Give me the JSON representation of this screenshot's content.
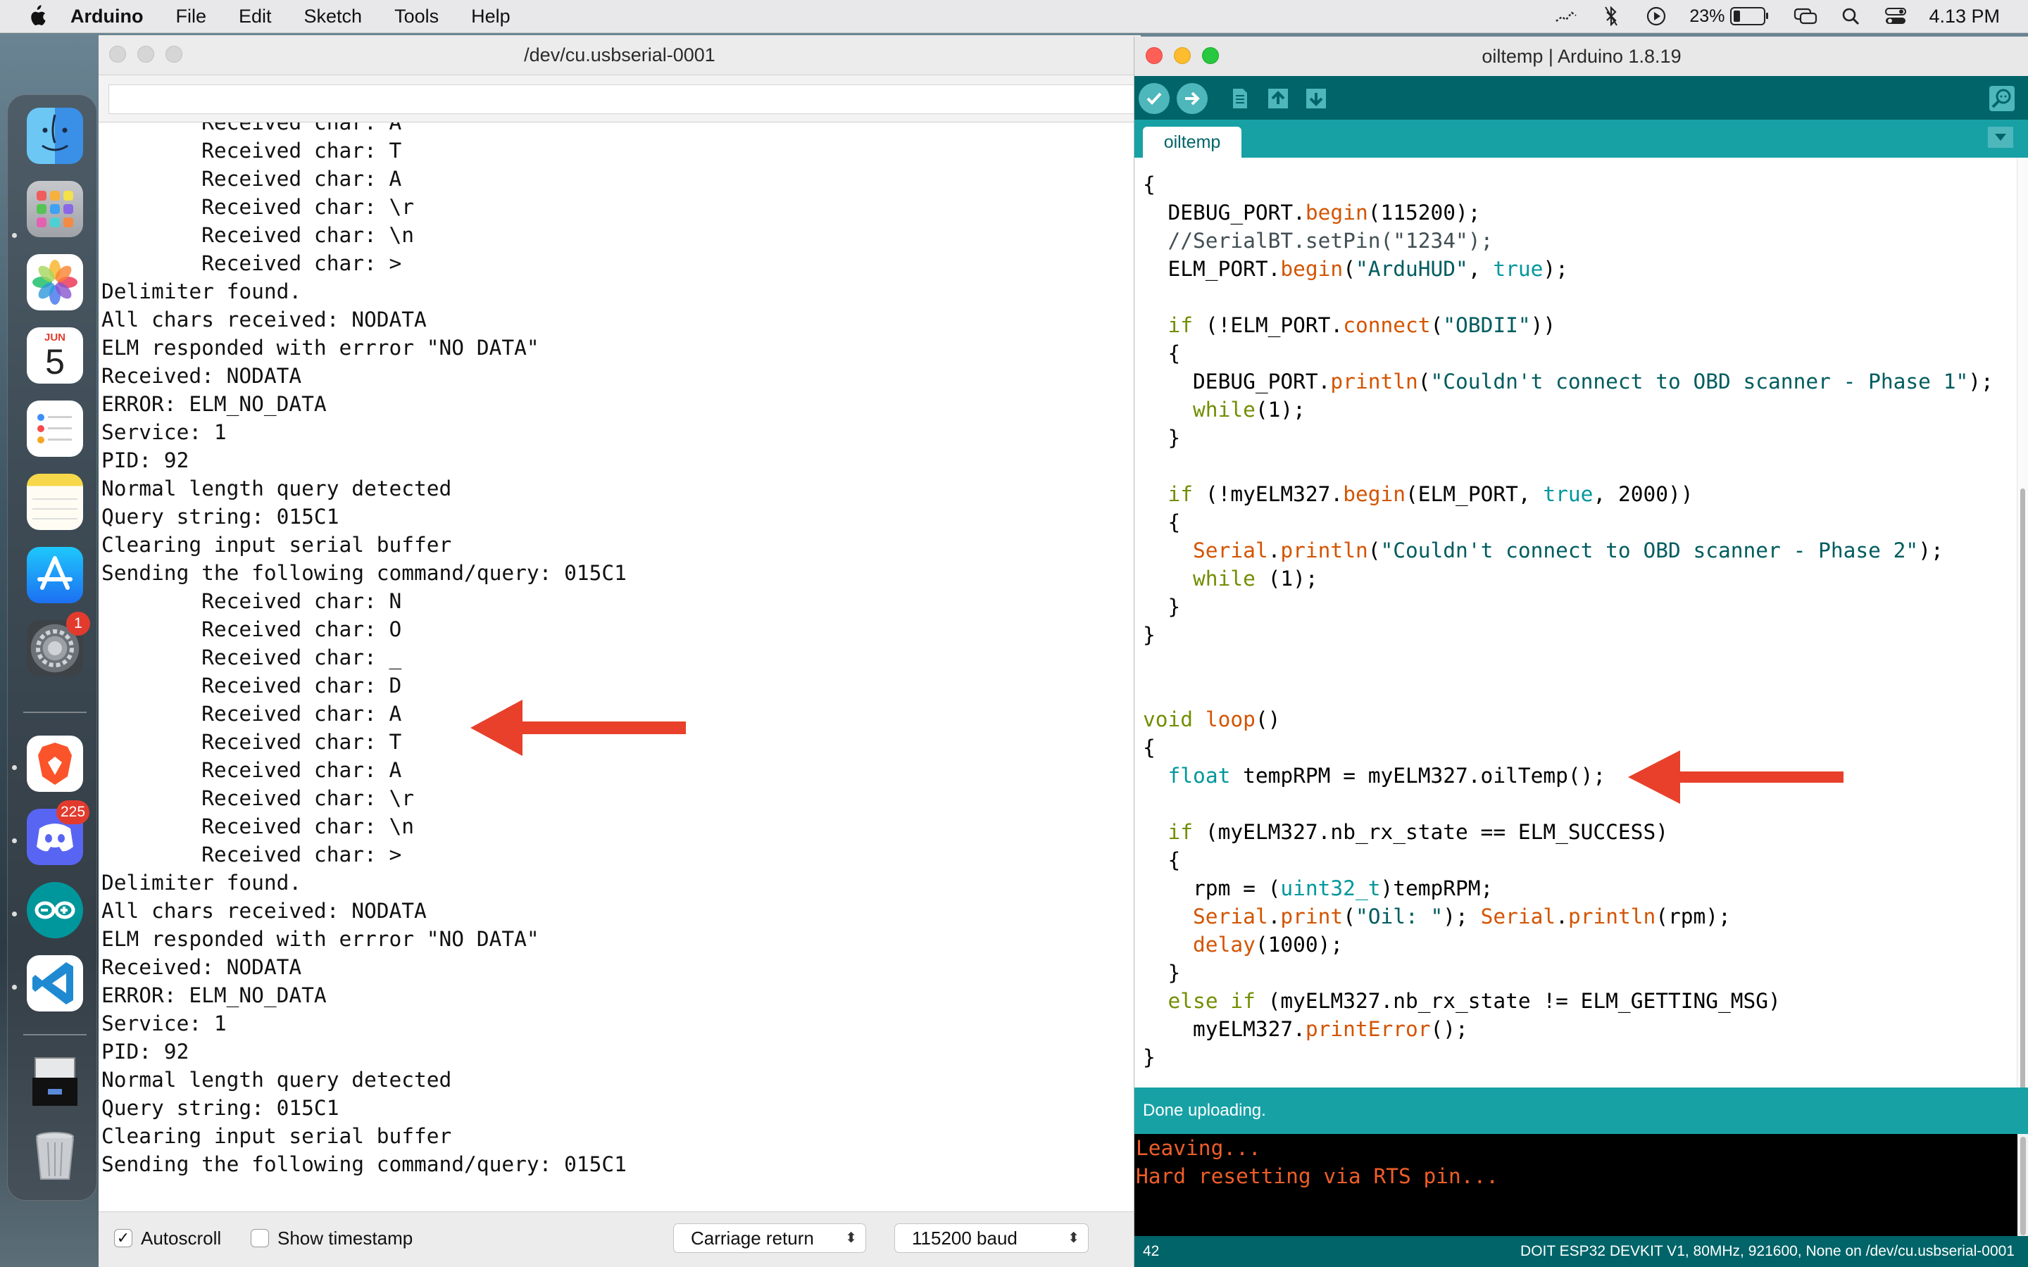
{
  "menubar": {
    "app_name": "Arduino",
    "menus": [
      "File",
      "Edit",
      "Sketch",
      "Tools",
      "Help"
    ],
    "battery_percent": "23%",
    "battery_level": 0.23,
    "clock": "4.13 PM"
  },
  "dock": {
    "apps": [
      {
        "name": "Finder",
        "icon": "finder-icon"
      },
      {
        "name": "Launchpad",
        "icon": "launchpad-icon"
      },
      {
        "name": "Photos",
        "icon": "photos-icon"
      },
      {
        "name": "Calendar",
        "icon": "calendar-icon",
        "month": "JUN",
        "day": "5"
      },
      {
        "name": "Reminders",
        "icon": "reminders-icon"
      },
      {
        "name": "Notes",
        "icon": "notes-icon"
      },
      {
        "name": "App Store",
        "icon": "app-store-icon"
      },
      {
        "name": "System Preferences",
        "icon": "system-preferences-icon",
        "badge": "1"
      },
      {
        "name": "Brave",
        "icon": "brave-icon"
      },
      {
        "name": "Discord",
        "icon": "discord-icon",
        "badge": "225"
      },
      {
        "name": "Arduino",
        "icon": "arduino-icon"
      },
      {
        "name": "Visual Studio Code",
        "icon": "vscode-icon"
      },
      {
        "name": "Document",
        "icon": "document-icon"
      },
      {
        "name": "Trash",
        "icon": "trash-icon"
      }
    ]
  },
  "serial_monitor": {
    "title": "/dev/cu.usbserial-0001",
    "input_value": "",
    "lines": [
      "        Received char: A",
      "        Received char: T",
      "        Received char: A",
      "        Received char: \\r",
      "        Received char: \\n",
      "        Received char: >",
      "Delimiter found.",
      "All chars received: NODATA",
      "ELM responded with errror \"NO DATA\"",
      "Received: NODATA",
      "ERROR: ELM_NO_DATA",
      "Service: 1",
      "PID: 92",
      "Normal length query detected",
      "Query string: 015C1",
      "Clearing input serial buffer",
      "Sending the following command/query: 015C1",
      "        Received char: N",
      "        Received char: O",
      "        Received char: _",
      "        Received char: D",
      "        Received char: A",
      "        Received char: T",
      "        Received char: A",
      "        Received char: \\r",
      "        Received char: \\n",
      "        Received char: >",
      "Delimiter found.",
      "All chars received: NODATA",
      "ELM responded with errror \"NO DATA\"",
      "Received: NODATA",
      "ERROR: ELM_NO_DATA",
      "Service: 1",
      "PID: 92",
      "Normal length query detected",
      "Query string: 015C1",
      "Clearing input serial buffer",
      "Sending the following command/query: 015C1"
    ],
    "autoscroll_label": "Autoscroll",
    "autoscroll_checked": true,
    "timestamp_label": "Show timestamp",
    "timestamp_checked": false,
    "line_ending": "Carriage return",
    "baud": "115200 baud"
  },
  "ide": {
    "title": "oiltemp | Arduino 1.8.19",
    "tab": "oiltemp",
    "toolbar": [
      {
        "name": "verify",
        "icon": "check-icon"
      },
      {
        "name": "upload",
        "icon": "arrow-right-icon"
      },
      {
        "name": "new",
        "icon": "new-file-icon"
      },
      {
        "name": "open",
        "icon": "open-icon"
      },
      {
        "name": "save",
        "icon": "save-icon"
      },
      {
        "name": "serial monitor",
        "icon": "serial-monitor-icon"
      }
    ],
    "code": [
      [
        [
          "{",
          ""
        ]
      ],
      [
        [
          "  ",
          ""
        ],
        [
          "DEBUG_PORT",
          ""
        ],
        [
          ".",
          ""
        ],
        [
          "begin",
          "kw-orange"
        ],
        [
          "(115200);",
          ""
        ]
      ],
      [
        [
          "  //SerialBT.setPin(\"1234\");",
          "cmt"
        ]
      ],
      [
        [
          "  ELM_PORT.",
          ""
        ],
        [
          "begin",
          "kw-orange"
        ],
        [
          "(",
          ""
        ],
        [
          "\"ArduHUD\"",
          "str"
        ],
        [
          ", ",
          ""
        ],
        [
          "true",
          "kw-teal"
        ],
        [
          ");",
          ""
        ]
      ],
      [
        [
          "",
          ""
        ]
      ],
      [
        [
          "  ",
          ""
        ],
        [
          "if",
          "kw-olive"
        ],
        [
          " (!ELM_PORT.",
          ""
        ],
        [
          "connect",
          "kw-orange"
        ],
        [
          "(",
          ""
        ],
        [
          "\"OBDII\"",
          "str"
        ],
        [
          "))",
          ""
        ]
      ],
      [
        [
          "  {",
          ""
        ]
      ],
      [
        [
          "    DEBUG_PORT.",
          ""
        ],
        [
          "println",
          "kw-orange"
        ],
        [
          "(",
          ""
        ],
        [
          "\"Couldn't connect to OBD scanner - Phase 1\"",
          "str"
        ],
        [
          ");",
          ""
        ]
      ],
      [
        [
          "    ",
          ""
        ],
        [
          "while",
          "kw-olive"
        ],
        [
          "(1);",
          ""
        ]
      ],
      [
        [
          "  }",
          ""
        ]
      ],
      [
        [
          "",
          ""
        ]
      ],
      [
        [
          "  ",
          ""
        ],
        [
          "if",
          "kw-olive"
        ],
        [
          " (!myELM327.",
          ""
        ],
        [
          "begin",
          "kw-orange"
        ],
        [
          "(ELM_PORT, ",
          ""
        ],
        [
          "true",
          "kw-teal"
        ],
        [
          ", 2000))",
          ""
        ]
      ],
      [
        [
          "  {",
          ""
        ]
      ],
      [
        [
          "    ",
          ""
        ],
        [
          "Serial",
          "kw-orange"
        ],
        [
          ".",
          ""
        ],
        [
          "println",
          "kw-orange"
        ],
        [
          "(",
          ""
        ],
        [
          "\"Couldn't connect to OBD scanner - Phase 2\"",
          "str"
        ],
        [
          ");",
          ""
        ]
      ],
      [
        [
          "    ",
          ""
        ],
        [
          "while",
          "kw-olive"
        ],
        [
          " (1);",
          ""
        ]
      ],
      [
        [
          "  }",
          ""
        ]
      ],
      [
        [
          "}",
          ""
        ]
      ],
      [
        [
          "",
          ""
        ]
      ],
      [
        [
          "",
          ""
        ]
      ],
      [
        [
          "void",
          "kw-olive"
        ],
        [
          " ",
          ""
        ],
        [
          "loop",
          "kw-orange"
        ],
        [
          "()",
          ""
        ]
      ],
      [
        [
          "{",
          ""
        ]
      ],
      [
        [
          "  ",
          ""
        ],
        [
          "float",
          "kw-teal"
        ],
        [
          " tempRPM = myELM327.oilTemp();",
          ""
        ]
      ],
      [
        [
          "",
          ""
        ]
      ],
      [
        [
          "  ",
          ""
        ],
        [
          "if",
          "kw-olive"
        ],
        [
          " (myELM327.nb_rx_state == ELM_SUCCESS)",
          ""
        ]
      ],
      [
        [
          "  {",
          ""
        ]
      ],
      [
        [
          "    rpm = (",
          ""
        ],
        [
          "uint32_t",
          "kw-teal"
        ],
        [
          ")tempRPM;",
          ""
        ]
      ],
      [
        [
          "    ",
          ""
        ],
        [
          "Serial",
          "kw-orange"
        ],
        [
          ".",
          ""
        ],
        [
          "print",
          "kw-orange"
        ],
        [
          "(",
          ""
        ],
        [
          "\"Oil: \"",
          "str"
        ],
        [
          "); ",
          ""
        ],
        [
          "Serial",
          "kw-orange"
        ],
        [
          ".",
          ""
        ],
        [
          "println",
          "kw-orange"
        ],
        [
          "(rpm);",
          ""
        ]
      ],
      [
        [
          "    ",
          ""
        ],
        [
          "delay",
          "kw-orange"
        ],
        [
          "(1000);",
          ""
        ]
      ],
      [
        [
          "  }",
          ""
        ]
      ],
      [
        [
          "  ",
          ""
        ],
        [
          "else",
          "kw-olive"
        ],
        [
          " ",
          ""
        ],
        [
          "if",
          "kw-olive"
        ],
        [
          " (myELM327.nb_rx_state != ELM_GETTING_MSG)",
          ""
        ]
      ],
      [
        [
          "    myELM327.",
          ""
        ],
        [
          "printError",
          "kw-orange"
        ],
        [
          "();",
          ""
        ]
      ],
      [
        [
          "}",
          ""
        ]
      ]
    ],
    "status": "Done uploading.",
    "console": [
      "Leaving...",
      "Hard resetting via RTS pin..."
    ],
    "line_number": "42",
    "board": "DOIT ESP32 DEVKIT V1, 80MHz, 921600, None on /dev/cu.usbserial-0001"
  },
  "colors": {
    "toolbar": "#006468",
    "tabbar": "#17a1a5",
    "arrow": "#e8402b",
    "console_text": "#ee5e28"
  }
}
